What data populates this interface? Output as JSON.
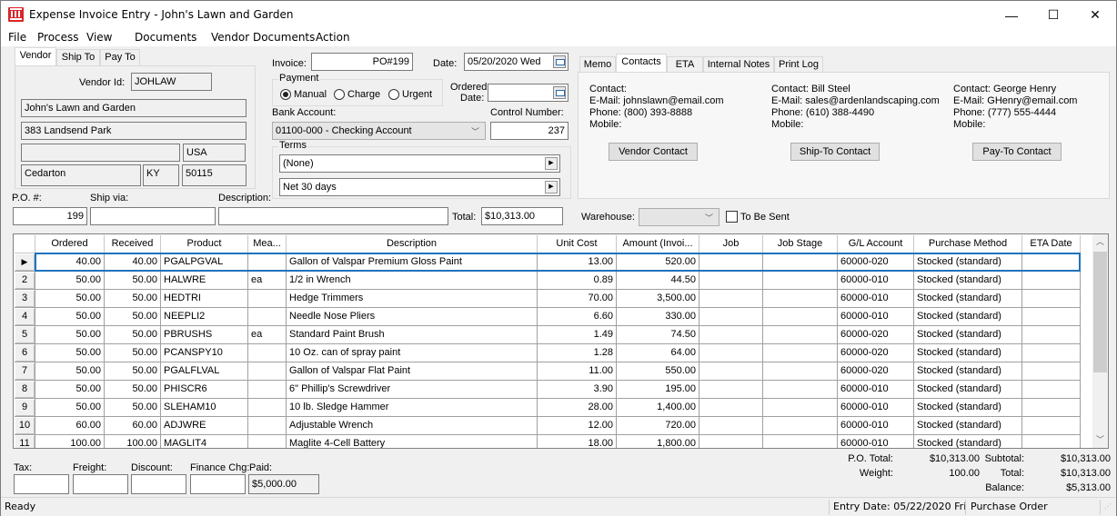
{
  "window": {
    "title": "Expense Invoice Entry - John's Lawn and Garden",
    "app_icon": "columns-building-icon",
    "controls": {
      "minimize": "—",
      "maximize": "☐",
      "close": "✕"
    }
  },
  "menu": [
    "File",
    "Process",
    "View",
    "Documents",
    "Vendor Documents",
    "Action"
  ],
  "vendor_tabs": [
    "Vendor",
    "Ship To",
    "Pay To"
  ],
  "vendor": {
    "id_label": "Vendor Id:",
    "id": "JOHLAW",
    "name": "John's Lawn and Garden",
    "address1": "383 Landsend Park",
    "address2": "",
    "country": "USA",
    "city": "Cedarton",
    "state": "KY",
    "zip": "50115"
  },
  "header": {
    "invoice_label": "Invoice:",
    "invoice": "PO#199",
    "date_label": "Date:",
    "date": "05/20/2020 Wed",
    "payment_label": "Payment",
    "payment_options": [
      "Manual",
      "Charge",
      "Urgent"
    ],
    "payment_selected": "Manual",
    "ordered_date_label_1": "Ordered",
    "ordered_date_label_2": "Date:",
    "ordered_date": "",
    "bank_account_label": "Bank Account:",
    "bank_account": "01100-000 - Checking Account",
    "control_number_label": "Control Number:",
    "control_number": "237",
    "terms_label": "Terms",
    "terms1": "(None)",
    "terms2": "Net  30 days",
    "po_label": "P.O. #:",
    "po": "199",
    "ship_via_label": "Ship via:",
    "ship_via": "",
    "description_label": "Description:",
    "description": "",
    "total_label": "Total:",
    "total": "$10,313.00",
    "warehouse_label": "Warehouse:",
    "warehouse": "",
    "to_be_sent_label": "To Be Sent",
    "to_be_sent": false
  },
  "info_tabs": [
    "Memo",
    "Contacts",
    "ETA",
    "Internal Notes",
    "Print Log"
  ],
  "info_tab_active": "Contacts",
  "contacts": [
    {
      "contact": "Contact:",
      "email": "E-Mail: johnslawn@email.com",
      "phone": "Phone: (800) 393-8888",
      "mobile": "Mobile:",
      "button": "Vendor Contact"
    },
    {
      "contact": "Contact: Bill Steel",
      "email": "E-Mail: sales@ardenlandscaping.com",
      "phone": "Phone: (610) 388-4490",
      "mobile": "Mobile:",
      "button": "Ship-To Contact"
    },
    {
      "contact": "Contact: George Henry",
      "email": "E-Mail: GHenry@email.com",
      "phone": "Phone: (777) 555-4444",
      "mobile": "Mobile:",
      "button": "Pay-To Contact"
    }
  ],
  "grid": {
    "columns": [
      "Ordered",
      "Received",
      "Product",
      "Mea...",
      "Description",
      "Unit Cost",
      "Amount (Invoi...",
      "Job",
      "Job Stage",
      "G/L Account",
      "Purchase Method",
      "ETA Date"
    ],
    "rows": [
      {
        "n": "▶",
        "ordered": "40.00",
        "received": "40.00",
        "product": "PGALPGVAL",
        "measure": "",
        "description": "Gallon of Valspar Premium Gloss Paint",
        "unit_cost": "13.00",
        "amount": "520.00",
        "job": "",
        "job_stage": "",
        "gl": "60000-020",
        "method": "Stocked (standard)",
        "eta": ""
      },
      {
        "n": "2",
        "ordered": "50.00",
        "received": "50.00",
        "product": "HALWRE",
        "measure": "ea",
        "description": "1/2 in Wrench",
        "unit_cost": "0.89",
        "amount": "44.50",
        "job": "",
        "job_stage": "",
        "gl": "60000-010",
        "method": "Stocked (standard)",
        "eta": ""
      },
      {
        "n": "3",
        "ordered": "50.00",
        "received": "50.00",
        "product": "HEDTRI",
        "measure": "",
        "description": "Hedge Trimmers",
        "unit_cost": "70.00",
        "amount": "3,500.00",
        "job": "",
        "job_stage": "",
        "gl": "60000-010",
        "method": "Stocked (standard)",
        "eta": ""
      },
      {
        "n": "4",
        "ordered": "50.00",
        "received": "50.00",
        "product": "NEEPLI2",
        "measure": "",
        "description": "Needle Nose Pliers",
        "unit_cost": "6.60",
        "amount": "330.00",
        "job": "",
        "job_stage": "",
        "gl": "60000-010",
        "method": "Stocked (standard)",
        "eta": ""
      },
      {
        "n": "5",
        "ordered": "50.00",
        "received": "50.00",
        "product": "PBRUSHS",
        "measure": "ea",
        "description": "Standard Paint Brush",
        "unit_cost": "1.49",
        "amount": "74.50",
        "job": "",
        "job_stage": "",
        "gl": "60000-020",
        "method": "Stocked (standard)",
        "eta": ""
      },
      {
        "n": "6",
        "ordered": "50.00",
        "received": "50.00",
        "product": "PCANSPY10",
        "measure": "",
        "description": "10 Oz. can of spray paint",
        "unit_cost": "1.28",
        "amount": "64.00",
        "job": "",
        "job_stage": "",
        "gl": "60000-020",
        "method": "Stocked (standard)",
        "eta": ""
      },
      {
        "n": "7",
        "ordered": "50.00",
        "received": "50.00",
        "product": "PGALFLVAL",
        "measure": "",
        "description": "Gallon of Valspar Flat Paint",
        "unit_cost": "11.00",
        "amount": "550.00",
        "job": "",
        "job_stage": "",
        "gl": "60000-020",
        "method": "Stocked (standard)",
        "eta": ""
      },
      {
        "n": "8",
        "ordered": "50.00",
        "received": "50.00",
        "product": "PHISCR6",
        "measure": "",
        "description": "6\" Phillip's Screwdriver",
        "unit_cost": "3.90",
        "amount": "195.00",
        "job": "",
        "job_stage": "",
        "gl": "60000-010",
        "method": "Stocked (standard)",
        "eta": ""
      },
      {
        "n": "9",
        "ordered": "50.00",
        "received": "50.00",
        "product": "SLEHAM10",
        "measure": "",
        "description": "10 lb. Sledge Hammer",
        "unit_cost": "28.00",
        "amount": "1,400.00",
        "job": "",
        "job_stage": "",
        "gl": "60000-010",
        "method": "Stocked (standard)",
        "eta": ""
      },
      {
        "n": "10",
        "ordered": "60.00",
        "received": "60.00",
        "product": "ADJWRE",
        "measure": "",
        "description": "Adjustable Wrench",
        "unit_cost": "12.00",
        "amount": "720.00",
        "job": "",
        "job_stage": "",
        "gl": "60000-010",
        "method": "Stocked (standard)",
        "eta": ""
      },
      {
        "n": "11",
        "ordered": "100.00",
        "received": "100.00",
        "product": "MAGLIT4",
        "measure": "",
        "description": "Maglite 4-Cell Battery",
        "unit_cost": "18.00",
        "amount": "1,800.00",
        "job": "",
        "job_stage": "",
        "gl": "60000-010",
        "method": "Stocked (standard)",
        "eta": ""
      }
    ]
  },
  "footer": {
    "tax_label": "Tax:",
    "tax": "",
    "freight_label": "Freight:",
    "freight": "",
    "discount_label": "Discount:",
    "discount": "",
    "finance_label": "Finance Chg:",
    "finance": "",
    "paid_label": "Paid:",
    "paid": "$5,000.00",
    "po_total_label": "P.O. Total:",
    "po_total": "$10,313.00",
    "weight_label": "Weight:",
    "weight": "100.00",
    "subtotal_label": "Subtotal:",
    "subtotal": "$10,313.00",
    "total_label": "Total:",
    "total": "$10,313.00",
    "balance_label": "Balance:",
    "balance": "$5,313.00"
  },
  "status": {
    "ready": "Ready",
    "entry_date": "Entry Date: 05/22/2020 Fri",
    "mode": "Purchase Order"
  }
}
